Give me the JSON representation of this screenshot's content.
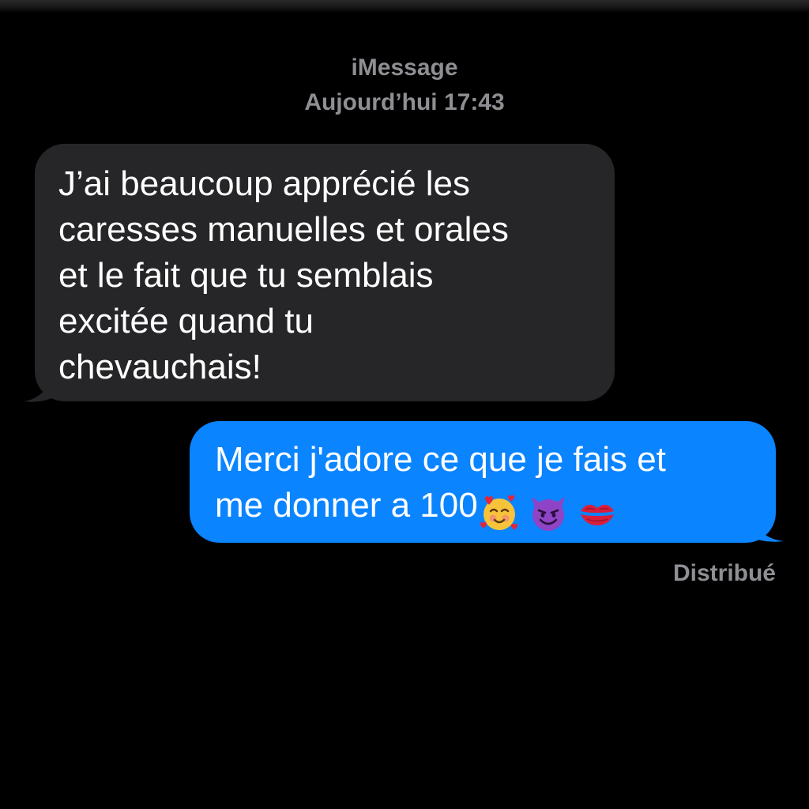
{
  "header": {
    "service": "iMessage",
    "timestamp": "Aujourd’hui 17:43"
  },
  "messages": [
    {
      "direction": "received",
      "lines": [
        "J’ai beaucoup apprécié les",
        "caresses manuelles et orales",
        "et le fait que tu semblais",
        "excitée quand tu",
        "chevauchais!"
      ]
    },
    {
      "direction": "sent",
      "lines": [
        "Merci j'adore ce que je fais et",
        "me donner a 100"
      ],
      "emojis": [
        "smiling-face-with-hearts-icon",
        "smiling-devil-icon",
        "kiss-mark-icon"
      ]
    }
  ],
  "status": "Distribué",
  "colors": {
    "background": "#000000",
    "received_bubble": "#262628",
    "sent_bubble": "#0a84ff",
    "meta_text": "#8e8e93",
    "message_text": "#ffffff"
  }
}
